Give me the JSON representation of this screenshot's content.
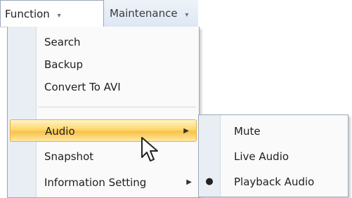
{
  "menubar": {
    "function_label": "Function",
    "maintenance_label": "Maintenance",
    "caret_glyph": "▾"
  },
  "function_menu": {
    "items": [
      {
        "label": "Search"
      },
      {
        "label": "Backup"
      },
      {
        "label": "Convert To AVI"
      },
      {
        "label": "Audio",
        "has_submenu": true,
        "highlighted": true
      },
      {
        "label": "Snapshot"
      },
      {
        "label": "Information Setting",
        "has_submenu": true
      }
    ],
    "submenu_arrow_glyph": "▶"
  },
  "audio_submenu": {
    "items": [
      {
        "label": "Mute"
      },
      {
        "label": "Live Audio"
      },
      {
        "label": "Playback Audio",
        "selected": true
      }
    ],
    "radio_glyph": "●"
  },
  "colors": {
    "highlight": "#ffd86b",
    "menubar_bg": "#dde7f3",
    "menu_bg": "#fafafa",
    "gutter": "#e9eef5"
  },
  "icons": {
    "pointer": "mouse-pointer-icon"
  }
}
